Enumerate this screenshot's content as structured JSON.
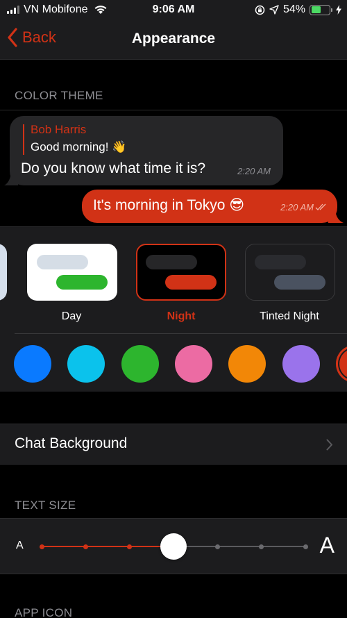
{
  "status_bar": {
    "carrier": "VN Mobifone",
    "time": "9:06 AM",
    "battery_percent": "54%",
    "battery_level": 0.54
  },
  "nav": {
    "back_label": "Back",
    "title": "Appearance"
  },
  "sections": {
    "color_theme": "COLOR THEME",
    "text_size": "TEXT SIZE",
    "app_icon": "APP ICON"
  },
  "preview": {
    "incoming": {
      "reply_name": "Bob Harris",
      "reply_text": "Good morning! 👋",
      "text": "Do you know what time it is?",
      "time": "2:20 AM"
    },
    "outgoing": {
      "text": "It's morning in Tokyo 😎",
      "time": "2:20 AM"
    }
  },
  "themes": [
    {
      "label": "Day",
      "selected": false
    },
    {
      "label": "Night",
      "selected": true
    },
    {
      "label": "Tinted Night",
      "selected": false
    }
  ],
  "accent_colors": [
    "#0a7aff",
    "#0bc2ec",
    "#2db52e",
    "#ec6ba3",
    "#f28707",
    "#9a73eb",
    "#d13216"
  ],
  "selected_accent": "#d13216",
  "chat_background": {
    "label": "Chat Background"
  },
  "text_size": {
    "small_label": "A",
    "large_label": "A",
    "steps": 7,
    "selected_index": 3
  },
  "colors": {
    "accent": "#d13216",
    "background": "#000000",
    "panel": "#1c1c1e"
  }
}
